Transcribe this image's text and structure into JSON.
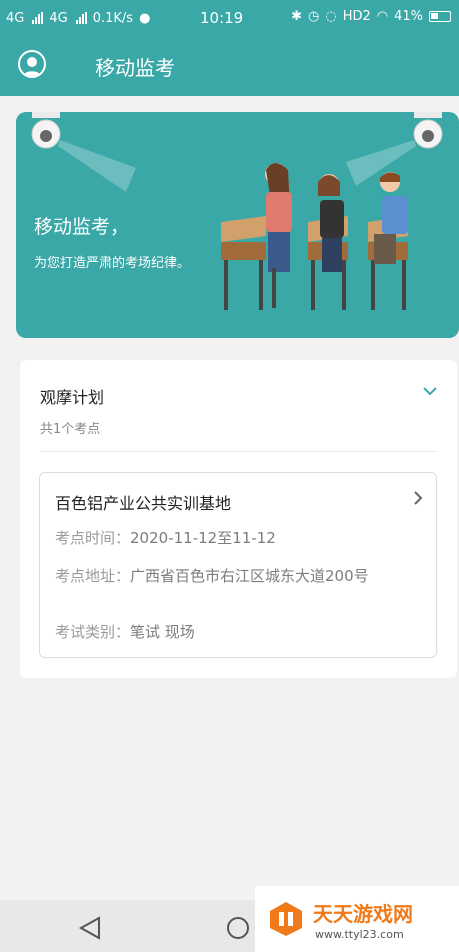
{
  "status_bar": {
    "network1": "4G",
    "network2": "4G",
    "speed": "0.1K/s",
    "time": "10:19",
    "hd": "HD2",
    "battery": "41%"
  },
  "appbar": {
    "title": "移动监考",
    "avatar_icon": "user-avatar-icon"
  },
  "banner": {
    "line1": "移动监考，",
    "line2": "为您打造严肃的考场纪律。"
  },
  "plan": {
    "title": "观摩计划",
    "subtitle": "共1个考点",
    "sites": [
      {
        "name": "百色铝产业公共实训基地",
        "time_label": "考点时间：",
        "time_value": "2020-11-12至11-12",
        "address_label": "考点地址：",
        "address_value": "广西省百色市右江区城东大道200号",
        "type_label": "考试类别：",
        "type_value": "笔试 现场"
      }
    ]
  },
  "watermark": {
    "title": "天天游戏网",
    "url": "www.ttyl23.com"
  },
  "colors": {
    "primary": "#3aa8a7",
    "card_bg": "#ffffff",
    "page_bg": "#f2f2f2"
  }
}
